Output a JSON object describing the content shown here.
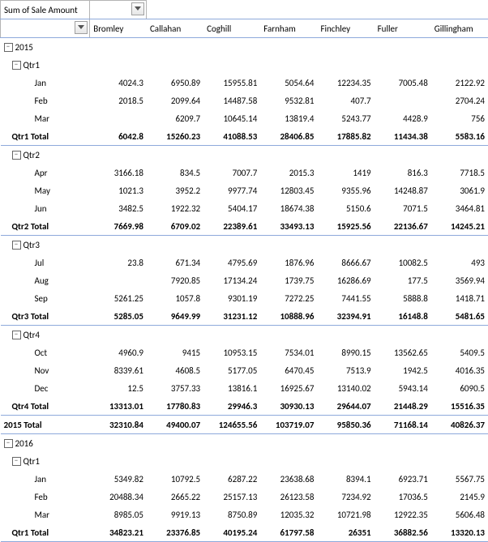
{
  "title": "Sum of Sale Amount",
  "columns": [
    "Bromley",
    "Callahan",
    "Coghill",
    "Farnham",
    "Finchley",
    "Fuller",
    "Gillingham"
  ],
  "chart_data": {
    "type": "table",
    "title": "Sum of Sale Amount",
    "columns": [
      "Bromley",
      "Callahan",
      "Coghill",
      "Farnham",
      "Finchley",
      "Fuller",
      "Gillingham"
    ],
    "rows": [
      {
        "level": 1,
        "label": "2015",
        "expand": "minus"
      },
      {
        "level": 2,
        "label": "Qtr1",
        "expand": "minus"
      },
      {
        "level": 3,
        "label": "Jan",
        "v": [
          4024.3,
          6950.89,
          15955.81,
          5054.64,
          12234.35,
          7005.48,
          2122.92
        ]
      },
      {
        "level": 3,
        "label": "Feb",
        "v": [
          2018.5,
          2099.64,
          14487.58,
          9532.81,
          407.7,
          null,
          2704.24
        ]
      },
      {
        "level": 3,
        "label": "Mar",
        "v": [
          null,
          6209.7,
          10645.14,
          13819.4,
          5243.77,
          4428.9,
          756
        ]
      },
      {
        "level": 2,
        "label": "Qtr1 Total",
        "total": true,
        "v": [
          6042.8,
          15260.23,
          41088.53,
          28406.85,
          17885.82,
          11434.38,
          5583.16
        ]
      },
      {
        "level": 2,
        "label": "Qtr2",
        "expand": "minus"
      },
      {
        "level": 3,
        "label": "Apr",
        "v": [
          3166.18,
          834.5,
          7007.7,
          2015.3,
          1419,
          816.3,
          7718.5
        ]
      },
      {
        "level": 3,
        "label": "May",
        "v": [
          1021.3,
          3952.2,
          9977.74,
          12803.45,
          9355.96,
          14248.87,
          3061.9
        ]
      },
      {
        "level": 3,
        "label": "Jun",
        "v": [
          3482.5,
          1922.32,
          5404.17,
          18674.38,
          5150.6,
          7071.5,
          3464.81
        ]
      },
      {
        "level": 2,
        "label": "Qtr2 Total",
        "total": true,
        "v": [
          7669.98,
          6709.02,
          22389.61,
          33493.13,
          15925.56,
          22136.67,
          14245.21
        ]
      },
      {
        "level": 2,
        "label": "Qtr3",
        "expand": "minus"
      },
      {
        "level": 3,
        "label": "Jul",
        "v": [
          23.8,
          671.34,
          4795.69,
          1876.96,
          8666.67,
          10082.5,
          493
        ]
      },
      {
        "level": 3,
        "label": "Aug",
        "v": [
          null,
          7920.85,
          17134.24,
          1739.75,
          16286.69,
          177.5,
          3569.94
        ]
      },
      {
        "level": 3,
        "label": "Sep",
        "v": [
          5261.25,
          1057.8,
          9301.19,
          7272.25,
          7441.55,
          5888.8,
          1418.71
        ]
      },
      {
        "level": 2,
        "label": "Qtr3 Total",
        "total": true,
        "v": [
          5285.05,
          9649.99,
          31231.12,
          10888.96,
          32394.91,
          16148.8,
          5481.65
        ]
      },
      {
        "level": 2,
        "label": "Qtr4",
        "expand": "minus"
      },
      {
        "level": 3,
        "label": "Oct",
        "v": [
          4960.9,
          9415,
          10953.15,
          7534.01,
          8990.15,
          13562.65,
          5409.5
        ]
      },
      {
        "level": 3,
        "label": "Nov",
        "v": [
          8339.61,
          4608.5,
          5177.05,
          6470.45,
          7513.9,
          1942.5,
          4016.35
        ]
      },
      {
        "level": 3,
        "label": "Dec",
        "v": [
          12.5,
          3757.33,
          13816.1,
          16925.67,
          13140.02,
          5943.14,
          6090.5
        ]
      },
      {
        "level": 2,
        "label": "Qtr4 Total",
        "total": true,
        "v": [
          13313.01,
          17780.83,
          29946.3,
          30930.13,
          29644.07,
          21448.29,
          15516.35
        ]
      },
      {
        "level": 1,
        "label": "2015 Total",
        "grand": true,
        "v": [
          32310.84,
          49400.07,
          124655.56,
          103719.07,
          95850.36,
          71168.14,
          40826.37
        ]
      },
      {
        "level": 1,
        "label": "2016",
        "expand": "minus",
        "section": true
      },
      {
        "level": 2,
        "label": "Qtr1",
        "expand": "minus"
      },
      {
        "level": 3,
        "label": "Jan",
        "v": [
          5349.82,
          10792.5,
          6287.22,
          23638.68,
          8394.1,
          6923.71,
          5567.75
        ]
      },
      {
        "level": 3,
        "label": "Feb",
        "v": [
          20488.34,
          2665.22,
          25157.13,
          26123.58,
          7234.92,
          17036.5,
          2145.9
        ]
      },
      {
        "level": 3,
        "label": "Mar",
        "v": [
          8985.05,
          9919.13,
          8750.89,
          12035.32,
          10721.98,
          12922.35,
          5606.48
        ]
      },
      {
        "level": 2,
        "label": "Qtr1 Total",
        "total": true,
        "v": [
          34823.21,
          23376.85,
          40195.24,
          61797.58,
          26351,
          36882.56,
          13320.13
        ]
      }
    ]
  }
}
